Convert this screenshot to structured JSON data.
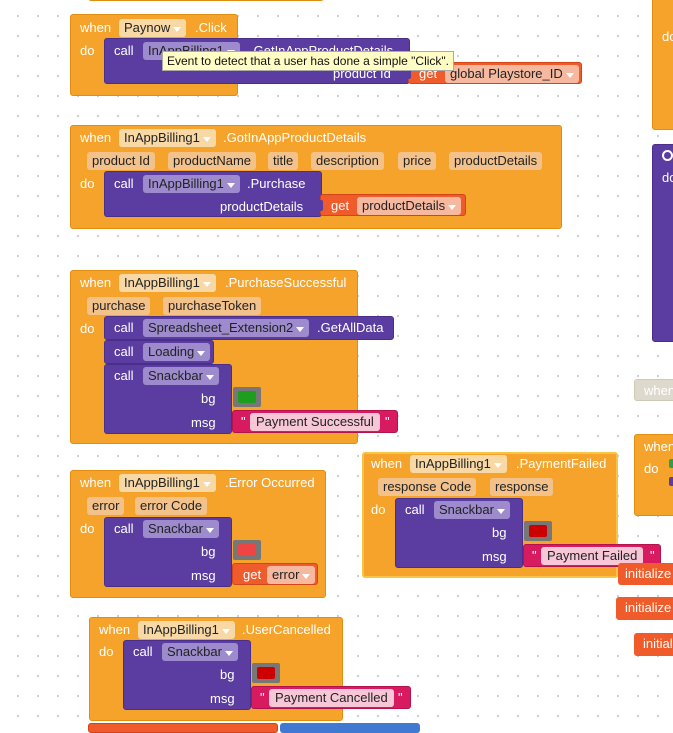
{
  "tooltip": "Event to detect that a user has done a simple \"Click\".",
  "kw": {
    "when": "when",
    "do": "do",
    "call": "call",
    "get": "get",
    "q": "\""
  },
  "b1": {
    "component": "Paynow",
    "event": ".Click",
    "call_comp": "InAppBilling1",
    "method": ".GetInAppProductDetails",
    "arg_label": "product Id",
    "var": "global Playstore_ID"
  },
  "b2": {
    "component": "InAppBilling1",
    "event": ".GotInAppProductDetails",
    "params": [
      "product Id",
      "productName",
      "title",
      "description",
      "price",
      "productDetails"
    ],
    "call_comp": "InAppBilling1",
    "method": ".Purchase",
    "arg_label": "productDetails",
    "var": "productDetails"
  },
  "b3": {
    "component": "InAppBilling1",
    "event": ".PurchaseSuccessful",
    "params": [
      "purchase",
      "purchaseToken"
    ],
    "call1_comp": "Spreadsheet_Extension2",
    "call1_method": ".GetAllData",
    "call2_comp": "Loading",
    "call3_comp": "Snackbar",
    "bg": "bg",
    "msg": "msg",
    "msg_text": "Payment Successful",
    "color": "#1e9e1e"
  },
  "b4": {
    "component": "InAppBilling1",
    "event": ".Error Occurred",
    "params": [
      "error",
      "error Code"
    ],
    "call_comp": "Snackbar",
    "bg": "bg",
    "msg": "msg",
    "var": "error",
    "color": "#ef4444"
  },
  "b5": {
    "component": "InAppBilling1",
    "event": ".PaymentFailed",
    "params": [
      "response Code",
      "response"
    ],
    "call_comp": "Snackbar",
    "bg": "bg",
    "msg": "msg",
    "msg_text": "Payment Failed",
    "color": "#cc0000"
  },
  "b6": {
    "component": "InAppBilling1",
    "event": ".UserCancelled",
    "call_comp": "Snackbar",
    "bg": "bg",
    "msg": "msg",
    "msg_text": "Payment Cancelled",
    "color": "#cc0000"
  },
  "right": {
    "when": "when",
    "when2": "when",
    "do": "do",
    "do2": "do",
    "init1": "initialize",
    "init2": "initialize",
    "init3": "initial"
  }
}
